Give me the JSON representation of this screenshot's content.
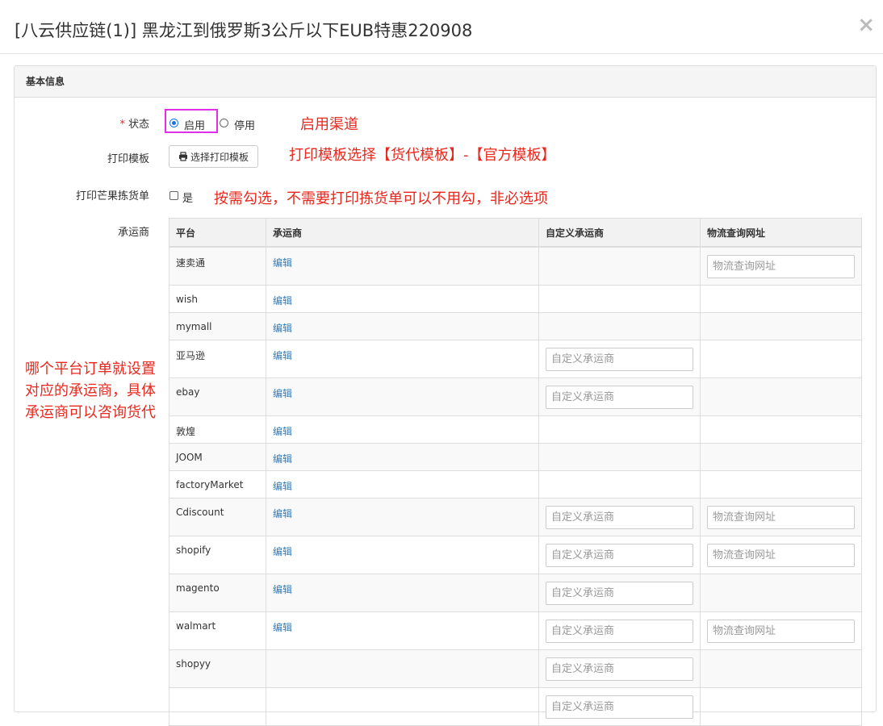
{
  "modal": {
    "title": "[八云供应链(1)] 黑龙江到俄罗斯3公斤以下EUB特惠220908",
    "close": "×"
  },
  "panel": {
    "title": "基本信息"
  },
  "form": {
    "required_mark": "*",
    "status_label": "状态",
    "status_on": "启用",
    "status_off": "停用",
    "print_template_label": "打印模板",
    "print_template_button": "选择打印模板",
    "print_pick_label": "打印芒果拣货单",
    "print_pick_option": "是",
    "carrier_label": "承运商"
  },
  "annotations": {
    "status": "启用渠道",
    "template": "打印模板选择【货代模板】-【官方模板】",
    "pick": "按需勾选，不需要打印拣货单可以不用勾，非必选项",
    "carrier_lines": [
      "哪个平台订单就设置",
      "对应的承运商，具体",
      "承运商可以咨询货代"
    ]
  },
  "table": {
    "headers": [
      "平台",
      "承运商",
      "自定义承运商",
      "物流查询网址"
    ],
    "edit_label": "编辑",
    "custom_placeholder": "自定义承运商",
    "url_placeholder": "物流查询网址",
    "rows": [
      {
        "platform": "速卖通",
        "edit": true,
        "custom": false,
        "url": true
      },
      {
        "platform": "wish",
        "edit": true,
        "custom": false,
        "url": false
      },
      {
        "platform": "mymall",
        "edit": true,
        "custom": false,
        "url": false
      },
      {
        "platform": "亚马逊",
        "edit": true,
        "custom": true,
        "url": false
      },
      {
        "platform": "ebay",
        "edit": true,
        "custom": true,
        "url": false
      },
      {
        "platform": "敦煌",
        "edit": true,
        "custom": false,
        "url": false
      },
      {
        "platform": "JOOM",
        "edit": true,
        "custom": false,
        "url": false
      },
      {
        "platform": "factoryMarket",
        "edit": true,
        "custom": false,
        "url": false
      },
      {
        "platform": "Cdiscount",
        "edit": true,
        "custom": true,
        "url": true
      },
      {
        "platform": "shopify",
        "edit": true,
        "custom": true,
        "url": true
      },
      {
        "platform": "magento",
        "edit": true,
        "custom": true,
        "url": false
      },
      {
        "platform": "walmart",
        "edit": true,
        "custom": true,
        "url": true
      },
      {
        "platform": "shopyy",
        "edit": false,
        "custom": true,
        "url": false
      },
      {
        "platform": "",
        "edit": false,
        "custom": true,
        "url": false
      }
    ]
  }
}
